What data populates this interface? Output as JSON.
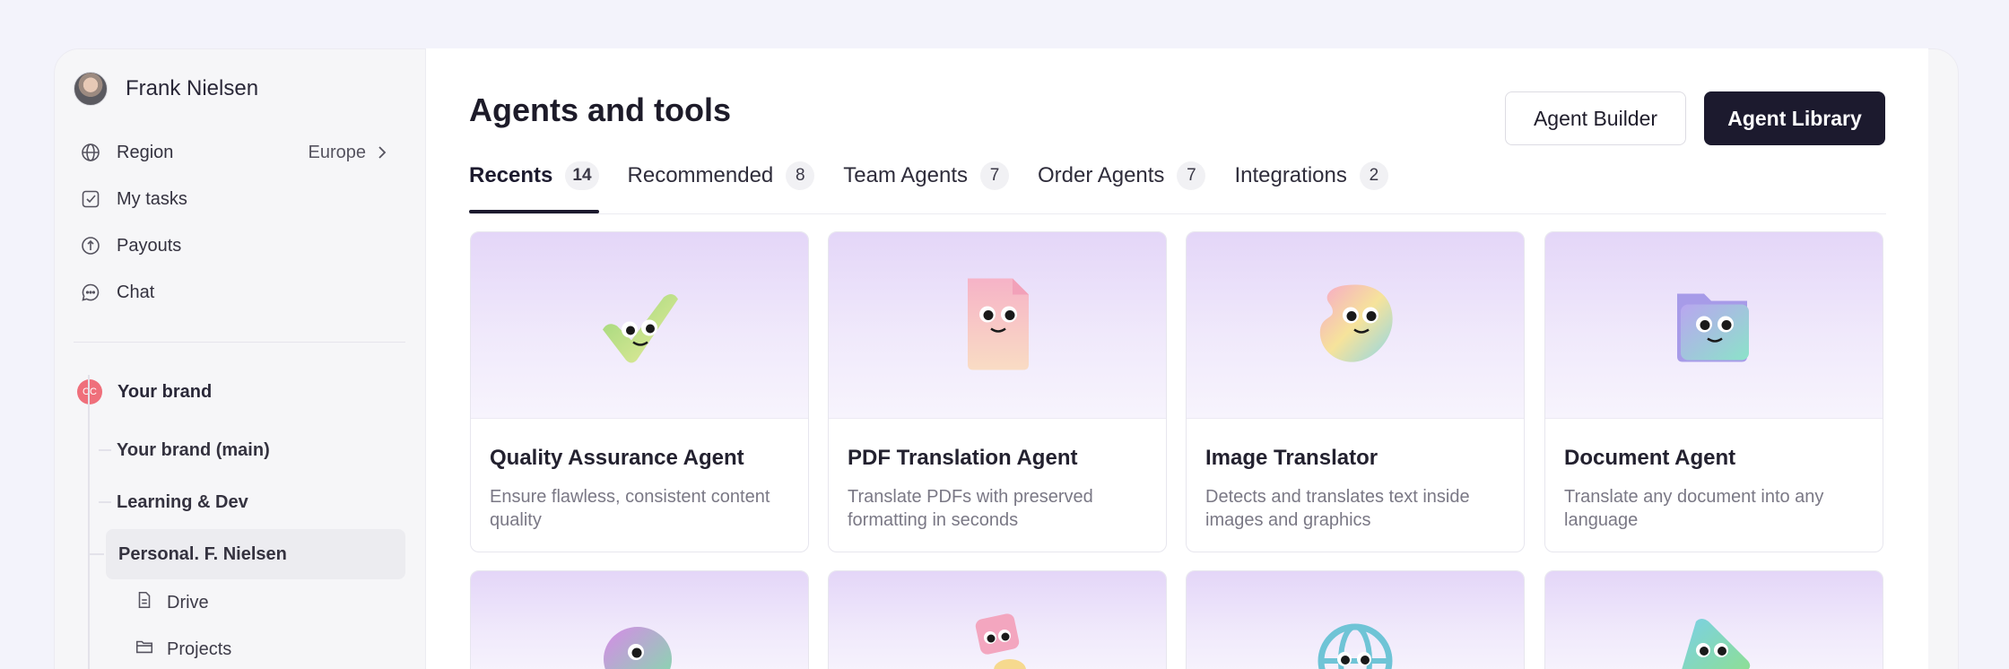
{
  "user": {
    "name": "Frank Nielsen"
  },
  "nav": [
    {
      "label": "Region",
      "value": "Europe",
      "icon": "globe-icon"
    },
    {
      "label": "My tasks",
      "icon": "checkbox-icon"
    },
    {
      "label": "Payouts",
      "icon": "payout-icon"
    },
    {
      "label": "Chat",
      "icon": "chat-icon"
    }
  ],
  "brand": {
    "badge": "CC",
    "label": "Your brand"
  },
  "tree": [
    {
      "label": "Your brand (main)"
    },
    {
      "label": "Learning & Dev"
    },
    {
      "label": "Personal. F. Nielsen"
    }
  ],
  "subitems": [
    {
      "label": "Drive",
      "icon": "file-icon"
    },
    {
      "label": "Projects",
      "icon": "folder-icon"
    }
  ],
  "page": {
    "title": "Agents and tools",
    "builder_label": "Agent Builder",
    "library_label": "Agent Library"
  },
  "tabs": [
    {
      "label": "Recents",
      "count": "14"
    },
    {
      "label": "Recommended",
      "count": "8"
    },
    {
      "label": "Team Agents",
      "count": "7"
    },
    {
      "label": "Order Agents",
      "count": "7"
    },
    {
      "label": "Integrations",
      "count": "2"
    }
  ],
  "cards": [
    {
      "title": "Quality Assurance Agent",
      "desc": "Ensure flawless, consistent content quality",
      "icon": "checkmark-mascot-icon"
    },
    {
      "title": "PDF Translation Agent",
      "desc": "Translate PDFs with preserved formatting in seconds",
      "icon": "document-mascot-icon"
    },
    {
      "title": "Image Translator",
      "desc": "Detects and translates text inside images and graphics",
      "icon": "palette-mascot-icon"
    },
    {
      "title": "Document Agent",
      "desc": "Translate any document into any language",
      "icon": "folder-mascot-icon"
    }
  ],
  "colors": {
    "accent": "#1c1a2e",
    "brand_badge": "#ef6f7b",
    "hero": "#e4d6f8"
  }
}
